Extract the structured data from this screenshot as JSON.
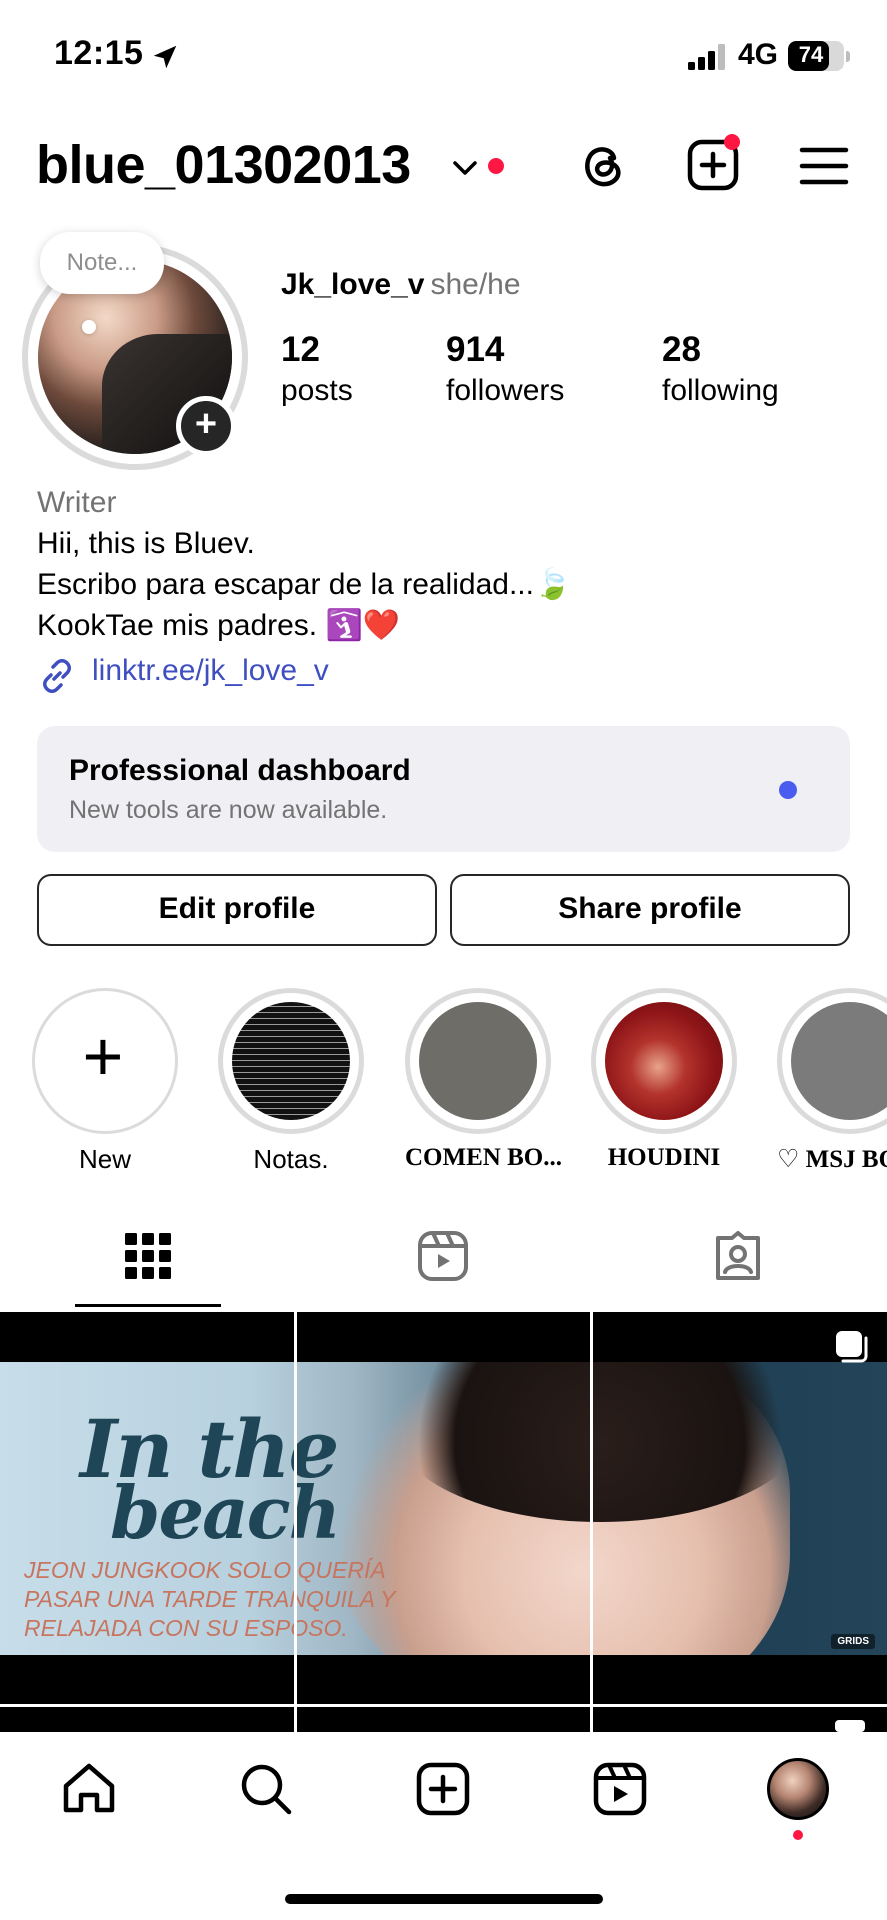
{
  "status_bar": {
    "time": "12:15",
    "network": "4G",
    "battery": "74",
    "battery_level": 0.74
  },
  "header": {
    "username": "blue_01302013",
    "icons": [
      "threads-icon",
      "create-icon",
      "menu-icon"
    ]
  },
  "profile": {
    "note_placeholder": "Note...",
    "display_name": "Jk_love_v",
    "pronouns": "she/he",
    "stats": [
      {
        "value": "12",
        "label": "posts"
      },
      {
        "value": "914",
        "label": "followers"
      },
      {
        "value": "28",
        "label": "following"
      }
    ],
    "category": "Writer",
    "bio_lines": [
      "Hii, this is Bluev.",
      "Escribo para escapar de la realidad...🍃",
      "KookTae mis padres. 🛐❤️"
    ],
    "link": "linktr.ee/jk_love_v"
  },
  "dashboard": {
    "title": "Professional dashboard",
    "subtitle": "New tools are now available."
  },
  "buttons": {
    "edit": "Edit profile",
    "share": "Share profile"
  },
  "highlights": [
    {
      "label": "New"
    },
    {
      "label": "Notas."
    },
    {
      "label": "COMEN BO..."
    },
    {
      "label": "HOUDINI"
    },
    {
      "label": "♡ MSJ BO"
    }
  ],
  "tabs": [
    "grid-icon",
    "reels-icon",
    "tagged-icon"
  ],
  "post": {
    "title_line1": "In the",
    "title_line2": "beach",
    "caption": "JEON JUNGKOOK SOLO QUERÍA PASAR UNA TARDE TRANQUILA Y RELAJADA CON SU ESPOSO.",
    "badge": "GRIDS"
  },
  "bottom_nav": [
    "home-icon",
    "search-icon",
    "create-icon",
    "reels-icon",
    "profile-avatar"
  ],
  "colors": {
    "accent_link": "#3f4fc0",
    "notification_red": "#ff1744",
    "dashboard_dot": "#4a5cf0",
    "dashboard_bg": "#efeff4"
  }
}
